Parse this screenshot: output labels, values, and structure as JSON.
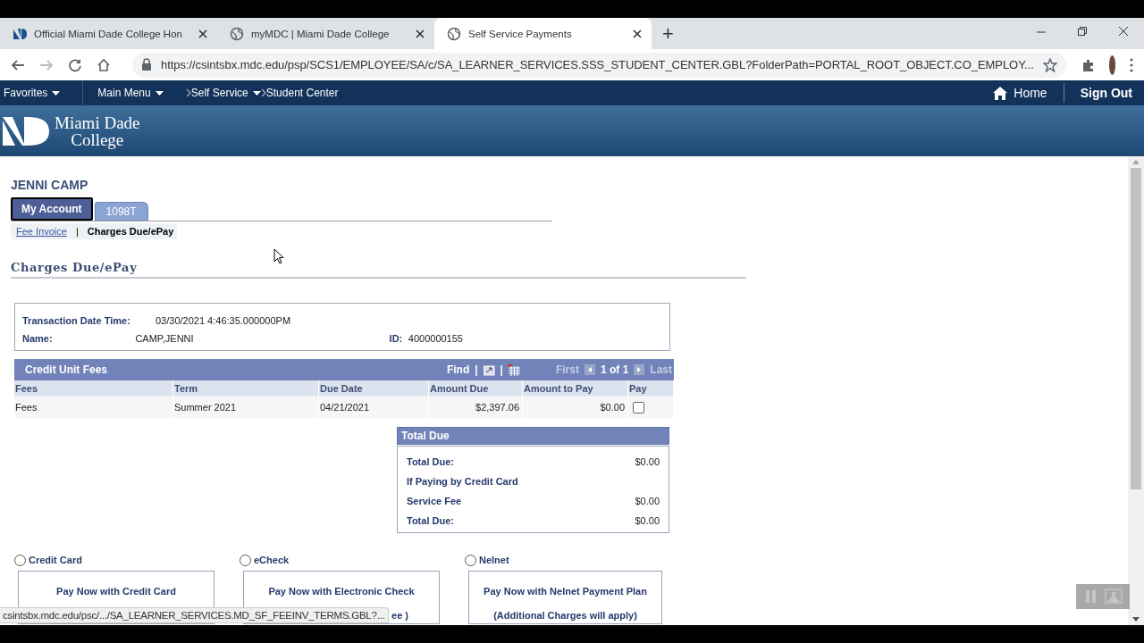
{
  "browser": {
    "tabs": [
      {
        "title": "Official Miami Dade College Hon",
        "selected": false
      },
      {
        "title": "myMDC | Miami Dade College",
        "selected": false
      },
      {
        "title": "Self Service Payments",
        "selected": true
      }
    ],
    "new_tab": "+",
    "url": "https://csintsbx.mdc.edu/psp/SCS1/EMPLOYEE/SA/c/SA_LEARNER_SERVICES.SSS_STUDENT_CENTER.GBL?FolderPath=PORTAL_ROOT_OBJECT.CO_EMPLOY...",
    "status_url": "csintsbx.mdc.edu/psc/.../SA_LEARNER_SERVICES.MD_SF_FEEINV_TERMS.GBL?..."
  },
  "nav": {
    "menus": [
      "Favorites",
      "Main Menu"
    ],
    "breadcrumb": [
      {
        "label": "Self Service",
        "dropdown": true
      },
      {
        "label": "Student Center",
        "dropdown": false
      }
    ],
    "home": "Home",
    "sign_out": "Sign Out"
  },
  "logo": {
    "line1": "Miami Dade",
    "line2": "College"
  },
  "student_name": "JENNI CAMP",
  "tabs": [
    {
      "label": "My Account",
      "selected": true
    },
    {
      "label": "1098T",
      "selected": false
    }
  ],
  "subnav": [
    {
      "label": "Fee Invoice",
      "selected": false
    },
    {
      "label": "Charges Due/ePay",
      "selected": true
    }
  ],
  "subnav_separator": "|",
  "page_title": "Charges Due/ePay",
  "info": {
    "fields": [
      {
        "label": "Transaction Date Time:",
        "value": "03/30/2021  4:46:35.000000PM"
      },
      {
        "label": "Name:",
        "value": "CAMP,JENNI"
      }
    ],
    "id_label": "ID:",
    "id_value": "4000000155"
  },
  "grid": {
    "title": "Credit Unit Fees",
    "find": "Find",
    "sep": "|",
    "first": "First",
    "range": "1 of 1",
    "last": "Last",
    "columns": [
      "Fees",
      "Term",
      "Due Date",
      "Amount Due",
      "Amount to Pay",
      "Pay"
    ],
    "rows": [
      {
        "cells": [
          "Fees",
          "Summer 2021",
          "04/21/2021",
          "$2,397.06",
          "$0.00"
        ],
        "pay": false
      }
    ]
  },
  "total_due": {
    "title": "Total Due",
    "lines": [
      {
        "label": "Total Due:",
        "value": "$0.00"
      },
      {
        "label": "If Paying by Credit Card"
      },
      {
        "label": "Service Fee",
        "value": "$0.00"
      },
      {
        "label": "Total Due:",
        "value": "$0.00"
      }
    ]
  },
  "payment_options": [
    {
      "label": "Credit Card",
      "selected": false,
      "lines": [
        "Pay Now with Credit Card"
      ]
    },
    {
      "label": "eCheck",
      "selected": false,
      "lines": [
        "Pay Now with Electronic Check",
        "ee )"
      ]
    },
    {
      "label": "Nelnet",
      "selected": false,
      "lines": [
        "Pay Now with Nelnet Payment Plan",
        "(Additional Charges will apply)"
      ]
    }
  ]
}
